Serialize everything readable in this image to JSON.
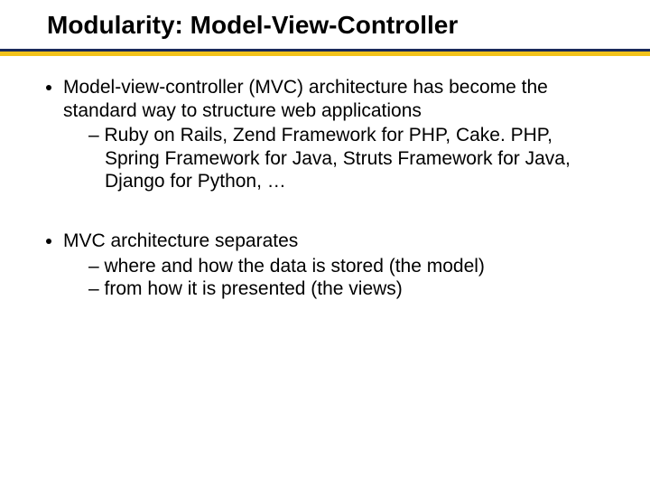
{
  "slide": {
    "title": "Modularity: Model-View-Controller",
    "bullets": [
      {
        "text": "Model-view-controller (MVC) architecture has become the standard way to structure web applications",
        "sub": [
          "Ruby on Rails, Zend Framework for PHP, Cake. PHP, Spring Framework for Java, Struts Framework for Java, Django for Python, …"
        ]
      },
      {
        "text": "MVC architecture separates",
        "sub": [
          "where and how the data is stored (the model)",
          " from how it is presented (the views)"
        ]
      }
    ]
  }
}
